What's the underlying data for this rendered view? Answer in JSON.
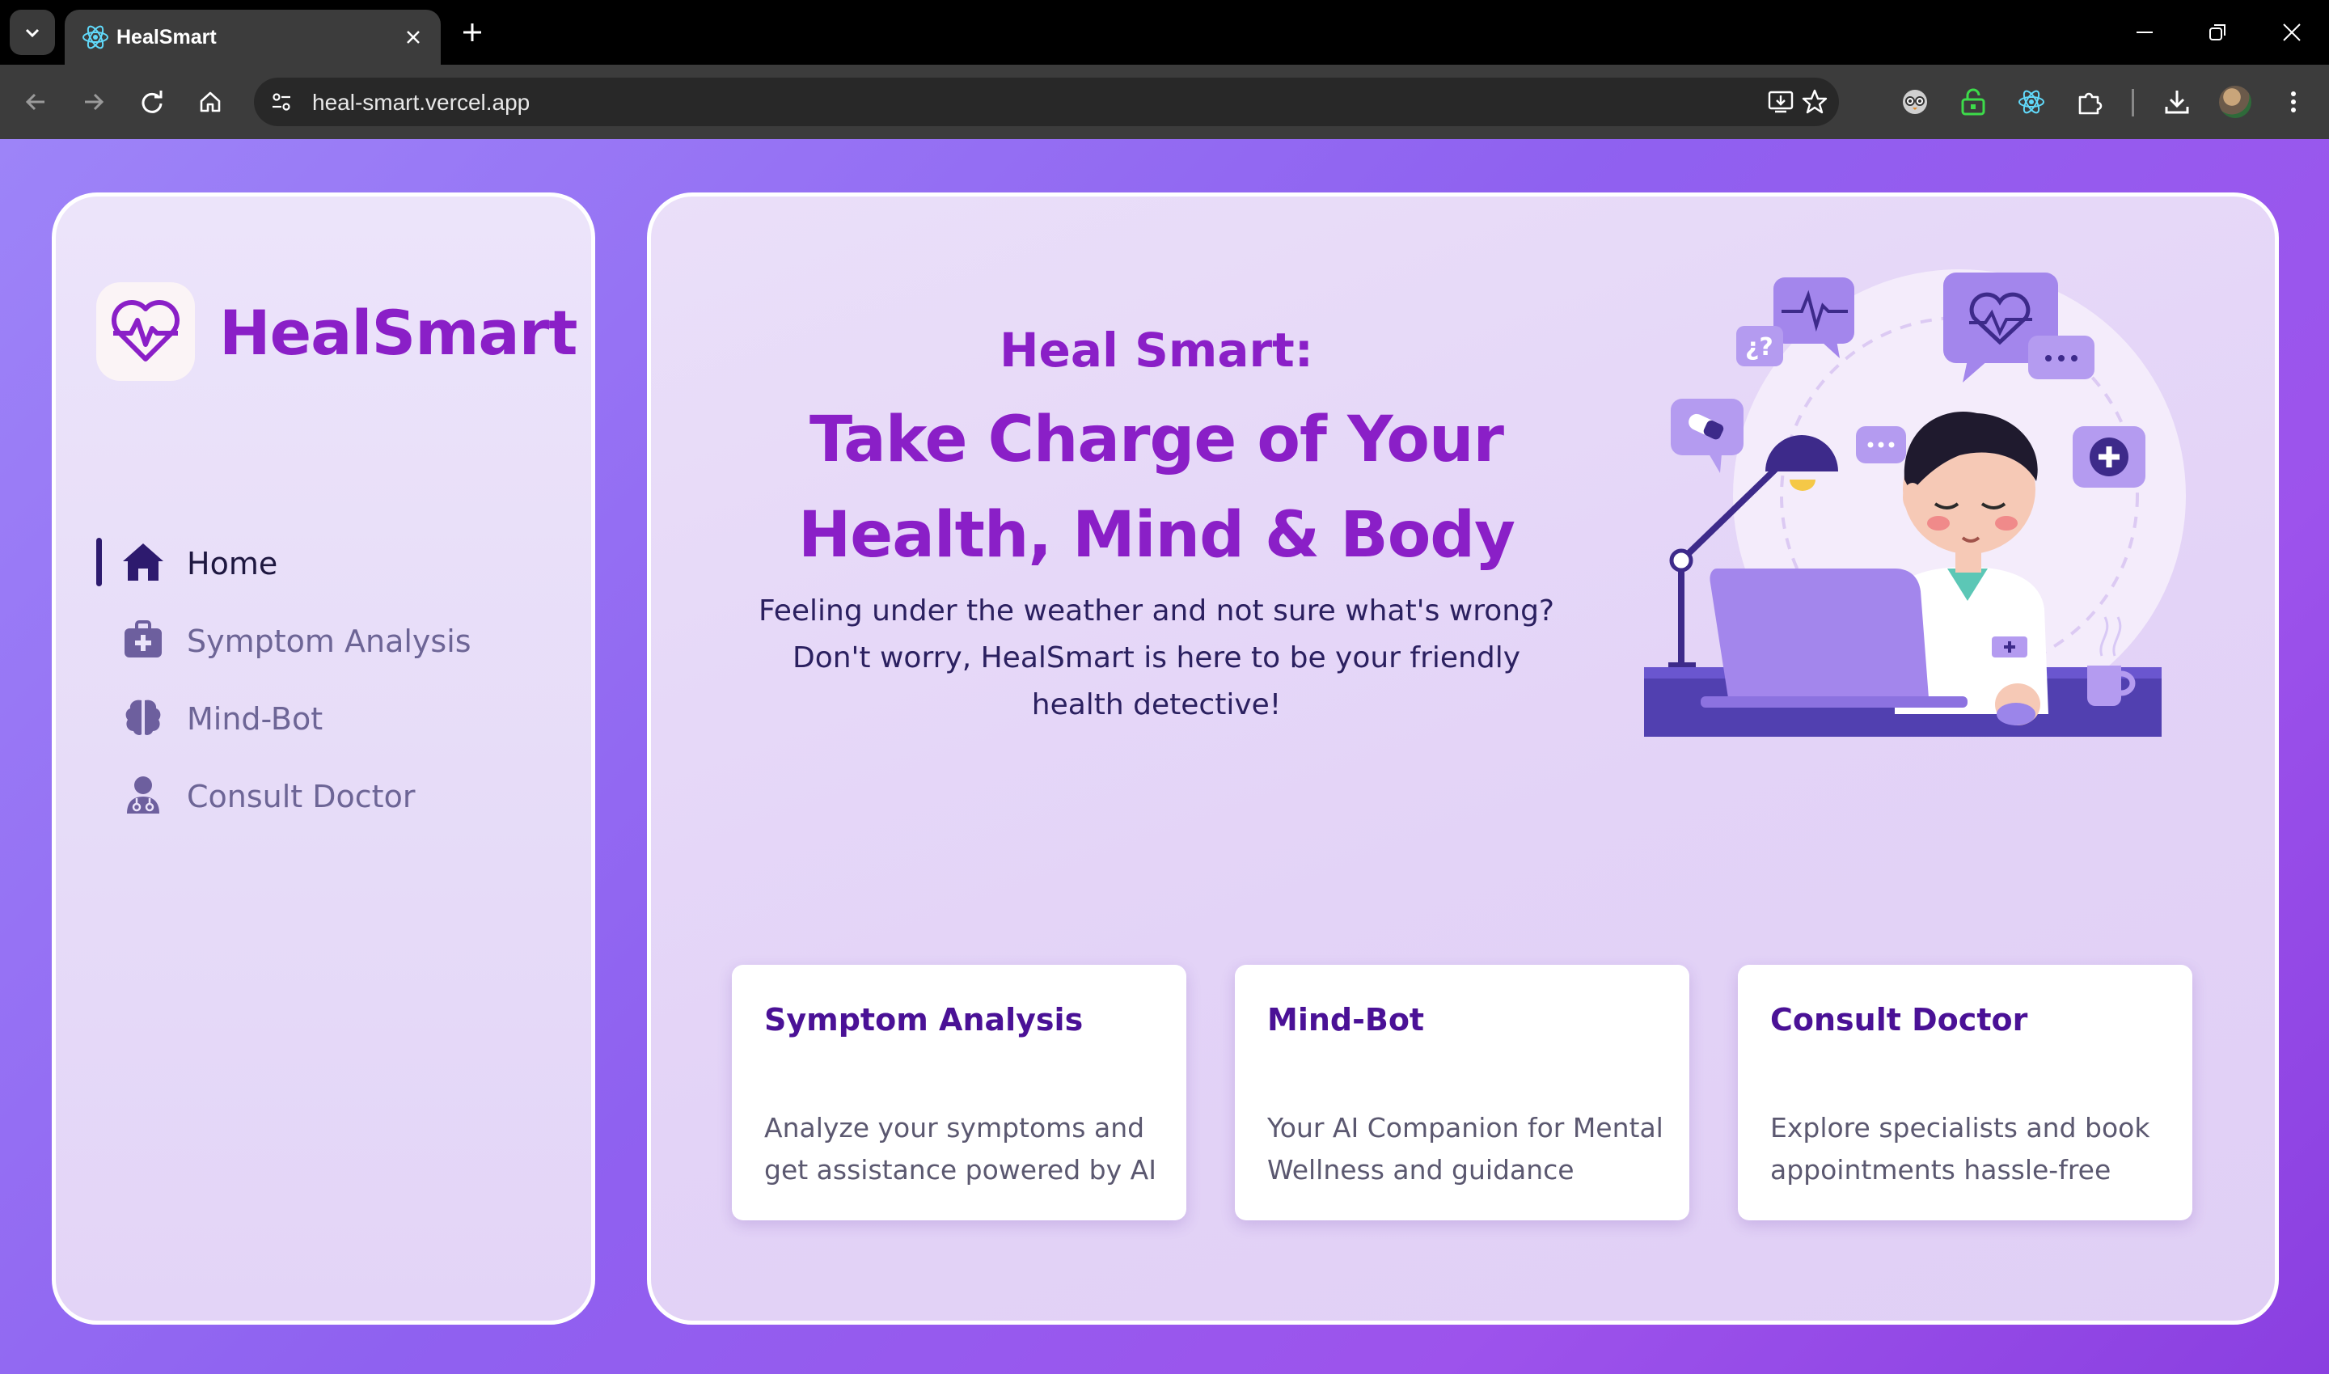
{
  "browser": {
    "tab_title": "HealSmart",
    "url": "heal-smart.vercel.app"
  },
  "sidebar": {
    "brand": "HealSmart",
    "items": [
      {
        "label": "Home",
        "icon": "home-icon",
        "active": true
      },
      {
        "label": "Symptom Analysis",
        "icon": "medical-kit-icon",
        "active": false
      },
      {
        "label": "Mind-Bot",
        "icon": "brain-icon",
        "active": false
      },
      {
        "label": "Consult Doctor",
        "icon": "doctor-icon",
        "active": false
      }
    ]
  },
  "hero": {
    "pretitle": "Heal Smart:",
    "title_line1": "Take Charge of Your",
    "title_line2": "Health, Mind & Body",
    "subtitle": "Feeling under the weather and not sure what's wrong? Don't worry, HealSmart is here to be your friendly health detective!"
  },
  "cards": [
    {
      "title": "Symptom Analysis",
      "description": "Analyze your symptoms and get assistance powered by AI"
    },
    {
      "title": "Mind-Bot",
      "description": "Your AI Companion for Mental Wellness and guidance"
    },
    {
      "title": "Consult Doctor",
      "description": "Explore specialists and book appointments hassle-free"
    }
  ],
  "colors": {
    "brand_purple": "#8a1fc7",
    "card_title": "#4a1196",
    "page_gradient_start": "#9d84f8",
    "page_gradient_end": "#8a3fe0"
  }
}
